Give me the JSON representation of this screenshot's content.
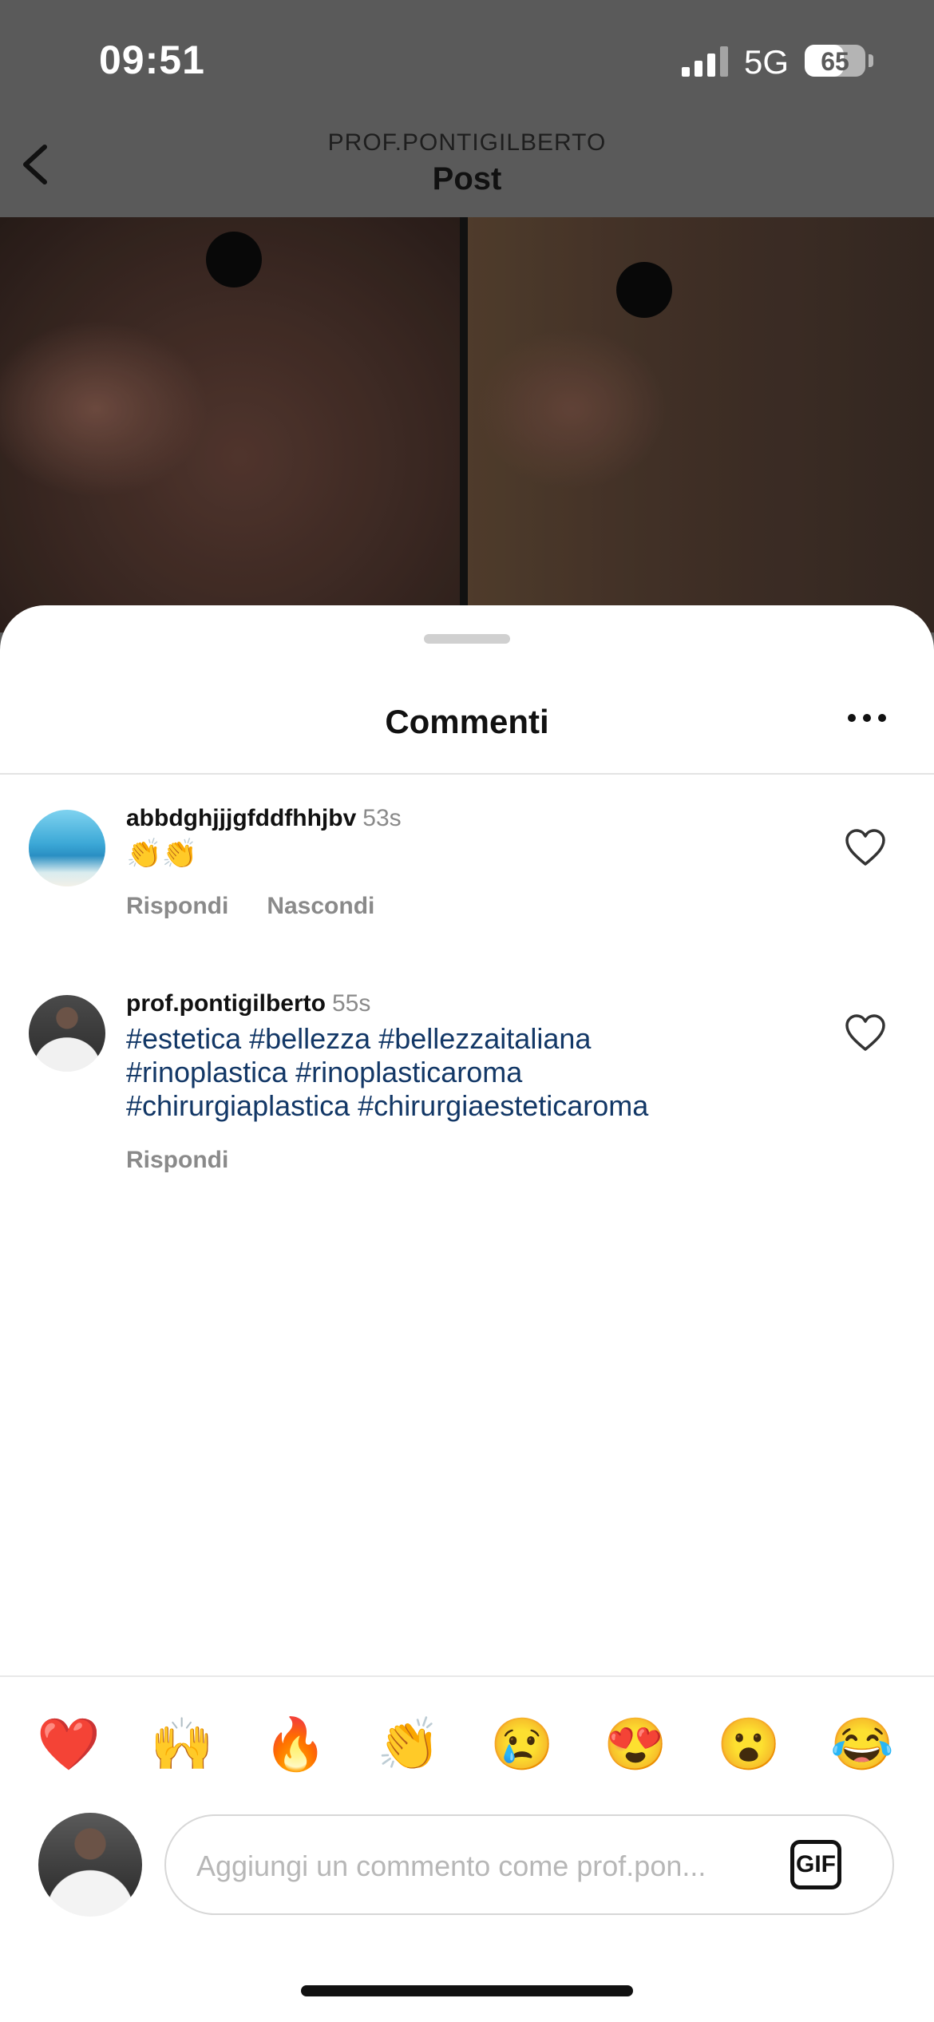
{
  "status_bar": {
    "time": "09:51",
    "network": "5G",
    "battery": "65",
    "battery_level": 0.65
  },
  "header": {
    "account": "PROF.PONTIGILBERTO",
    "title": "Post",
    "back_icon": "chevron-left-icon"
  },
  "comments_sheet": {
    "title": "Commenti",
    "more_icon": "ellipsis-icon",
    "comments": [
      {
        "username": "abbdghjjjgfddfhhjbv",
        "time": "53s",
        "text": "👏👏",
        "actions": [
          "Rispondi",
          "Nascondi"
        ]
      },
      {
        "username": "prof.pontigilberto",
        "time": "55s",
        "lines": [
          "#estetica #bellezza #bellezzaitaliana",
          "#rinoplastica #rinoplasticaroma",
          "#chirurgiaplastica #chirurgiaesteticaroma"
        ],
        "actions": [
          "Rispondi"
        ]
      }
    ]
  },
  "quick_reactions": [
    "❤️",
    "🙌",
    "🔥",
    "👏",
    "😢",
    "😍",
    "😮",
    "😂"
  ],
  "composer": {
    "placeholder": "Aggiungi un commento come prof.pon...",
    "gif_label": "GIF"
  },
  "colors": {
    "hashtag": "#123766",
    "muted": "#8a8a8a",
    "overlay": "#5a5a5a"
  }
}
